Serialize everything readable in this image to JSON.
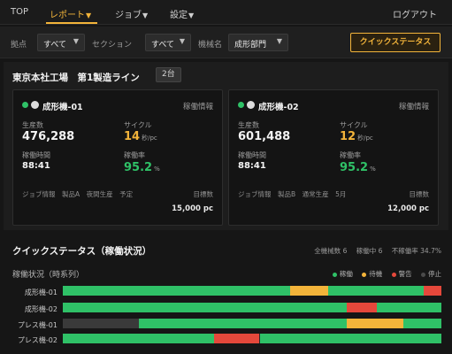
{
  "nav": {
    "items": [
      {
        "label": "TOP",
        "caret": "",
        "active": false
      },
      {
        "label": "レポート",
        "caret": "▼",
        "active": true
      },
      {
        "label": "ジョブ",
        "caret": "▼",
        "active": false
      },
      {
        "label": "設定",
        "caret": "▼",
        "active": false
      }
    ],
    "logout": "ログアウト"
  },
  "filters": {
    "location_label": "拠点",
    "location_value": "すべて",
    "section_label": "セクション",
    "section_value": "すべて",
    "machine_label": "機械名",
    "machine_value": "成形部門",
    "quick_status_button": "クイックステータス"
  },
  "line": {
    "title": "東京本社工場　第1製造ライン",
    "count": "2台"
  },
  "cards": [
    {
      "name": "成形機-01",
      "status": "稼働情報",
      "production_label": "生産数",
      "production": "476,288",
      "cycle_label": "サイクル",
      "cycle": "14",
      "cycle_unit": "秒/pc",
      "uptime_label": "稼働時間",
      "uptime": "88:41",
      "rate_label": "稼働率",
      "rate": "95.2",
      "rate_unit": "%",
      "job_info": "ジョブ情報　製品A　夜間生産　予定",
      "target_label": "目標数",
      "target": "15,000 pc"
    },
    {
      "name": "成形機-02",
      "status": "稼働情報",
      "production_label": "生産数",
      "production": "601,488",
      "cycle_label": "サイクル",
      "cycle": "12",
      "cycle_unit": "秒/pc",
      "uptime_label": "稼働時間",
      "uptime": "88:41",
      "rate_label": "稼働率",
      "rate": "95.2",
      "rate_unit": "%",
      "job_info": "ジョブ情報　製品B　通常生産　5月",
      "target_label": "目標数",
      "target": "12,000 pc"
    }
  ],
  "quick_status": {
    "title": "クイックステータス（稼働状況）",
    "total": "全機械数 6",
    "running": "稼働中 6",
    "nonrunning": "不稼働率 34.7%",
    "timeline_label": "稼働状況（時系列）",
    "legend": [
      {
        "label": "稼働",
        "color": "#2fc167"
      },
      {
        "label": "待機",
        "color": "#f3b43a"
      },
      {
        "label": "警告",
        "color": "#e5483b"
      },
      {
        "label": "停止",
        "color": "#4a4a4a"
      }
    ]
  },
  "colors": {
    "running": "#2fc167",
    "waiting": "#f3b43a",
    "alarm": "#e5483b",
    "stopped": "#3a3a3a",
    "accent": "#f3b43a"
  },
  "timeline_rows": [
    {
      "label": "成形機-01",
      "segments": [
        {
          "state": "running",
          "from": 0.0,
          "to": 0.6
        },
        {
          "state": "waiting",
          "from": 0.6,
          "to": 0.7
        },
        {
          "state": "running",
          "from": 0.7,
          "to": 0.953
        },
        {
          "state": "alarm",
          "from": 0.953,
          "to": 1.0
        }
      ]
    },
    {
      "label": "成形機-02",
      "segments": [
        {
          "state": "running",
          "from": 0.0,
          "to": 0.75
        },
        {
          "state": "alarm",
          "from": 0.75,
          "to": 0.83
        },
        {
          "state": "running",
          "from": 0.83,
          "to": 1.0
        }
      ]
    },
    {
      "label": "プレス機-01",
      "segments": [
        {
          "state": "stopped",
          "from": 0.0,
          "to": 0.2
        },
        {
          "state": "running",
          "from": 0.2,
          "to": 0.75
        },
        {
          "state": "waiting",
          "from": 0.75,
          "to": 0.9
        },
        {
          "state": "running",
          "from": 0.9,
          "to": 1.0
        }
      ]
    },
    {
      "label": "プレス機-02",
      "segments": [
        {
          "state": "running",
          "from": 0.0,
          "to": 0.4
        },
        {
          "state": "alarm",
          "from": 0.4,
          "to": 0.52
        },
        {
          "state": "running",
          "from": 0.52,
          "to": 1.0
        }
      ]
    }
  ]
}
